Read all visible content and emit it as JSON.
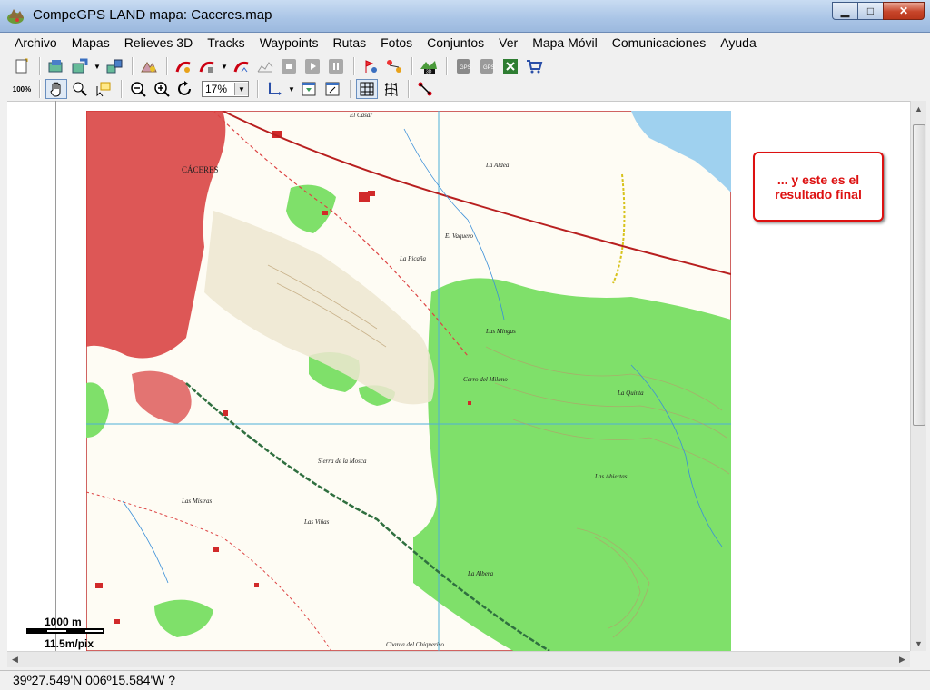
{
  "window": {
    "title": "CompeGPS LAND mapa: Caceres.map",
    "min": "▁",
    "max": "□",
    "close": "✕"
  },
  "menu": [
    "Archivo",
    "Mapas",
    "Relieves 3D",
    "Tracks",
    "Waypoints",
    "Rutas",
    "Fotos",
    "Conjuntos",
    "Ver",
    "Mapa Móvil",
    "Comunicaciones",
    "Ayuda"
  ],
  "toolbar": {
    "zoom_value": "17%",
    "zoom100_label": "100%"
  },
  "map": {
    "labels": [
      "CÁCERES",
      "El Casar",
      "La Aldea",
      "El Vaquero",
      "La Picaña",
      "Las Mingas",
      "Cerro del Milano",
      "La Quinta",
      "Las Abiertas",
      "La Albera",
      "Sierra de la Mosca",
      "Charca del Chiqueriso",
      "Las Mistras",
      "Las Viñas"
    ],
    "accent_red": "#cc1f1f",
    "forest_green": "#7fe06a",
    "water_blue": "#9fd1ef"
  },
  "callout": {
    "text": "... y este es el resultado final"
  },
  "scale": {
    "distance": "1000 m",
    "resolution": "11.5m/pix"
  },
  "status": {
    "coords": "39º27.549'N 006º15.584'W  ?"
  }
}
